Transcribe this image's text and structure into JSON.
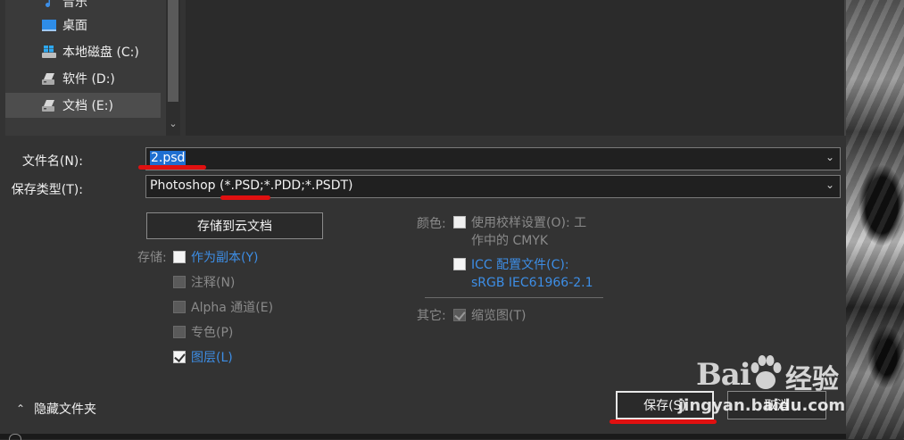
{
  "nav": {
    "items": [
      {
        "label": "音乐",
        "icon": "music-icon"
      },
      {
        "label": "桌面",
        "icon": "desktop-icon"
      },
      {
        "label": "本地磁盘 (C:)",
        "icon": "windows-drive-icon"
      },
      {
        "label": "软件 (D:)",
        "icon": "drive-icon"
      },
      {
        "label": "文档 (E:)",
        "icon": "drive-icon"
      }
    ],
    "selected_index": 4
  },
  "filename": {
    "label": "文件名(N):",
    "value": "2.psd"
  },
  "filetype": {
    "label": "保存类型(T):",
    "value": "Photoshop (*.PSD;*.PDD;*.PSDT)"
  },
  "cloud_button": "存储到云文档",
  "storage": {
    "label": "存储:",
    "options": [
      {
        "label": "作为副本(Y)",
        "checked": false,
        "enabled": true
      },
      {
        "label": "注释(N)",
        "checked": false,
        "enabled": false
      },
      {
        "label": "Alpha 通道(E)",
        "checked": false,
        "enabled": false
      },
      {
        "label": "专色(P)",
        "checked": false,
        "enabled": false
      },
      {
        "label": "图层(L)",
        "checked": true,
        "enabled": true
      }
    ]
  },
  "color": {
    "label": "颜色:",
    "proof_line1": "使用校样设置(O):  工",
    "proof_line2": "作中的 CMYK",
    "icc_line1": "ICC 配置文件(C):",
    "icc_line2": "sRGB IEC61966-2.1"
  },
  "other": {
    "label": "其它:",
    "thumbnail": "缩览图(T)",
    "thumbnail_checked": true
  },
  "hide_folders": "隐藏文件夹",
  "save_button": "保存(S)",
  "cancel_button": "取消",
  "watermark": {
    "brand_a": "Bai",
    "brand_b": "经验",
    "url": "jingyan.baidu.com"
  },
  "colors": {
    "accent": "#1f6fd1",
    "link": "#3d8ee6",
    "annotation": "#e01010",
    "dialog_bg": "#333333"
  }
}
